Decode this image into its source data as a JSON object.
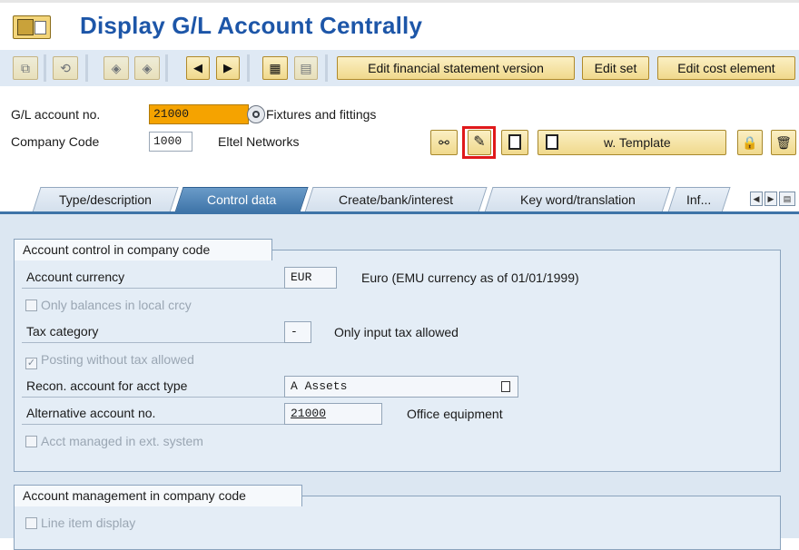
{
  "title": "Display G/L Account Centrally",
  "toolbar": {
    "edit_fs_version": "Edit financial statement version",
    "edit_set": "Edit set",
    "edit_cost_element": "Edit cost element"
  },
  "header": {
    "gl_account_label": "G/L account no.",
    "gl_account_value": "21000",
    "gl_account_desc": "Fixtures and fittings",
    "company_code_label": "Company Code",
    "company_code_value": "1000",
    "company_name": "Eltel Networks",
    "template_button": "w. Template"
  },
  "tabs": [
    {
      "label": "Type/description",
      "active": false
    },
    {
      "label": "Control data",
      "active": true
    },
    {
      "label": "Create/bank/interest",
      "active": false
    },
    {
      "label": "Key word/translation",
      "active": false
    },
    {
      "label": "Inf...",
      "active": false
    }
  ],
  "account_control": {
    "title": "Account control in company code",
    "currency_label": "Account currency",
    "currency_value": "EUR",
    "currency_desc": "Euro (EMU currency as of 01/01/1999)",
    "only_balances_label": "Only balances in local crcy",
    "only_balances_checked": false,
    "tax_category_label": "Tax category",
    "tax_category_value": "-",
    "tax_category_desc": "Only input tax allowed",
    "posting_without_tax_label": "Posting without tax allowed",
    "posting_without_tax_checked": true,
    "recon_label": "Recon. account for acct type",
    "recon_value": "A Assets",
    "alt_account_label": "Alternative account no.",
    "alt_account_value": "21000",
    "alt_account_desc": "Office equipment",
    "acct_managed_label": "Acct managed in ext. system",
    "acct_managed_checked": false
  },
  "account_management": {
    "title": "Account management in company code",
    "line_item_label": "Line item display",
    "line_item_checked": false
  },
  "colors": {
    "title_blue": "#1d56a8",
    "tab_active": "#3e74a8",
    "field_highlight": "#f5a300",
    "edit_highlight": "#e0191b"
  }
}
